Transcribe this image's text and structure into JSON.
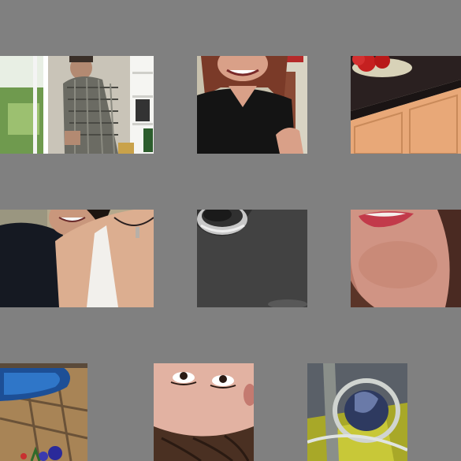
{
  "page": {
    "background": "#808080"
  },
  "tiles": [
    {
      "name": "man-in-plaid-shirt-by-window-photo"
    },
    {
      "name": "smiling-woman-black-top-photo"
    },
    {
      "name": "kitchen-counter-apples-photo"
    },
    {
      "name": "smiling-couple-photo"
    },
    {
      "name": "dark-surface-object-photo"
    },
    {
      "name": "woman-smile-closeup-photo"
    },
    {
      "name": "pool-and-flowers-photo"
    },
    {
      "name": "upside-down-face-photo"
    },
    {
      "name": "metal-chair-reflection-photo"
    }
  ]
}
